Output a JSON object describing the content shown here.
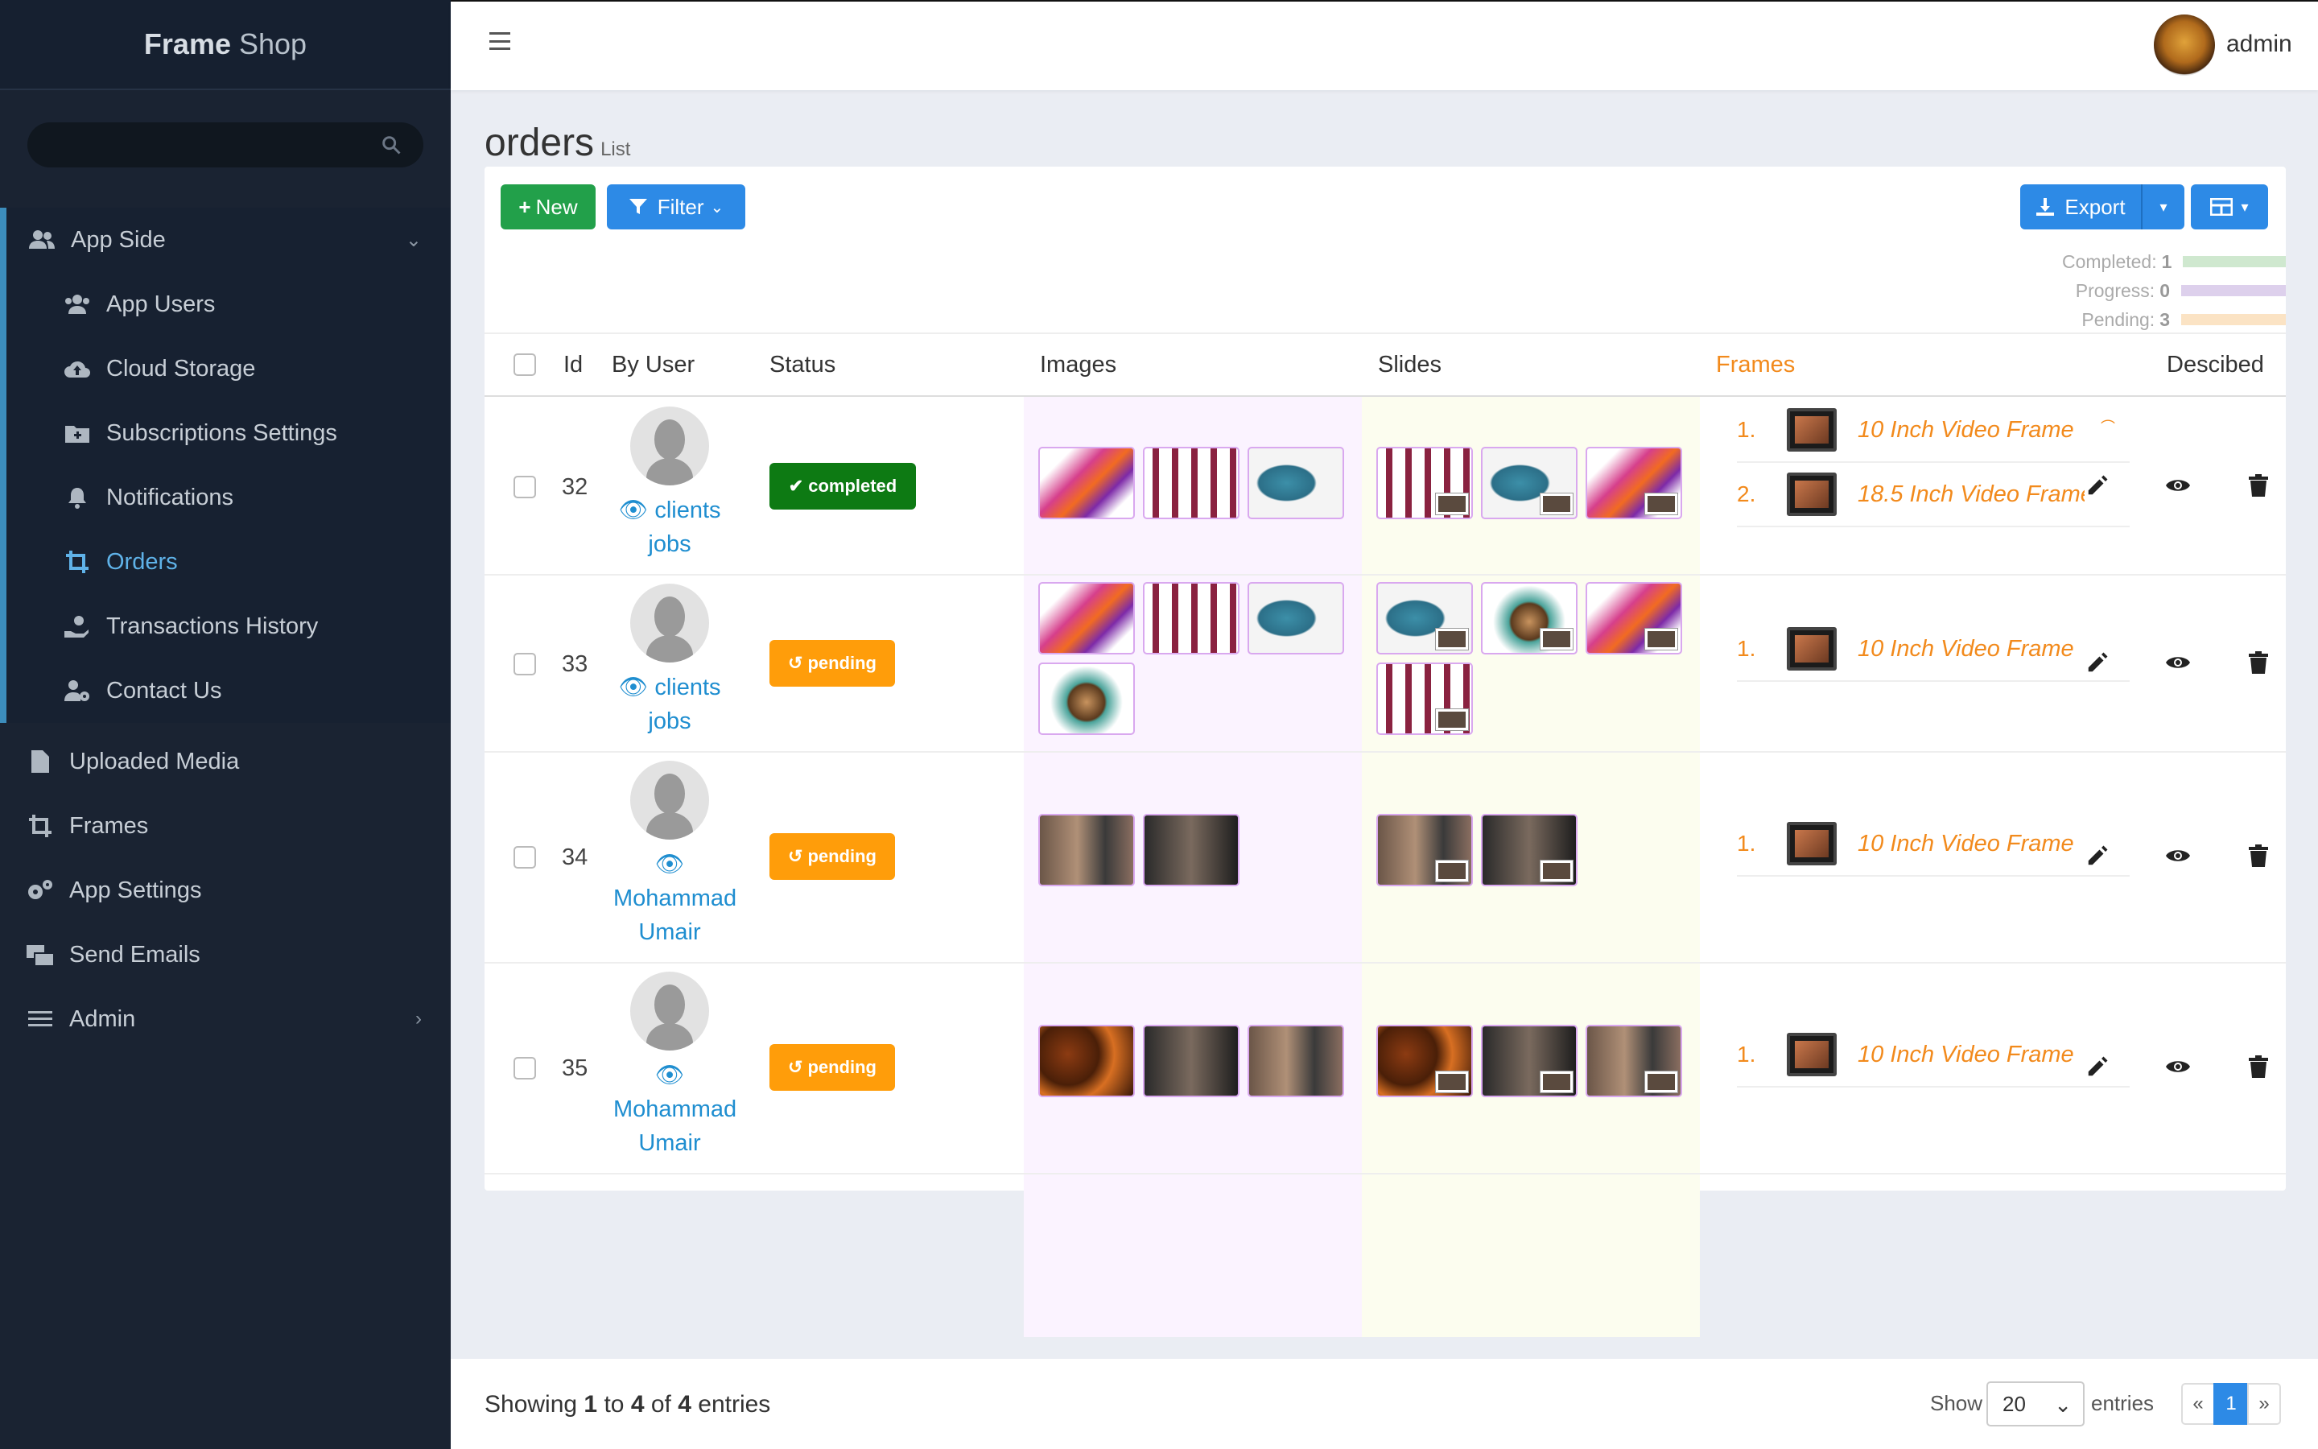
{
  "brand": {
    "bold": "Frame",
    "rest": "Shop"
  },
  "sidebar": {
    "group": {
      "label": "App Side",
      "items": [
        {
          "label": "App Users",
          "icon": "users-icon"
        },
        {
          "label": "Cloud Storage",
          "icon": "cloud-upload-icon"
        },
        {
          "label": "Subscriptions Settings",
          "icon": "folder-plus-icon"
        },
        {
          "label": "Notifications",
          "icon": "bell-icon"
        },
        {
          "label": "Orders",
          "icon": "crop-icon",
          "active": true
        },
        {
          "label": "Transactions History",
          "icon": "hand-coin-icon"
        },
        {
          "label": "Contact Us",
          "icon": "user-gear-icon"
        }
      ]
    },
    "items": [
      {
        "label": "Uploaded Media",
        "icon": "file-icon"
      },
      {
        "label": "Frames",
        "icon": "crop-icon"
      },
      {
        "label": "App Settings",
        "icon": "gears-icon"
      },
      {
        "label": "Send Emails",
        "icon": "mail-bulk-icon"
      },
      {
        "label": "Admin",
        "icon": "bars-icon"
      }
    ]
  },
  "header": {
    "user": "admin"
  },
  "page": {
    "title": "orders",
    "subtitle": "List"
  },
  "toolbar": {
    "new": "New",
    "filter": "Filter",
    "export": "Export"
  },
  "stats": {
    "completed_label": "Completed:",
    "completed": "1",
    "progress_label": "Progress:",
    "progress": "0",
    "pending_label": "Pending:",
    "pending": "3",
    "colors": {
      "completed": "#cfe8cf",
      "progress": "#ddd0ec",
      "pending": "#fbe3c4"
    }
  },
  "table": {
    "headers": {
      "id": "Id",
      "user": "By User",
      "status": "Status",
      "images": "Images",
      "slides": "Slides",
      "frames": "Frames",
      "desc": "Descibed"
    },
    "rows": [
      {
        "id": "32",
        "user": "clients jobs",
        "status": "completed",
        "frames": [
          {
            "n": "1.",
            "name": "10 Inch Video Frame"
          },
          {
            "n": "2.",
            "name": "18.5 Inch Video Frame"
          }
        ]
      },
      {
        "id": "33",
        "user": "clients jobs",
        "status": "pending",
        "frames": [
          {
            "n": "1.",
            "name": "10 Inch Video Frame"
          }
        ]
      },
      {
        "id": "34",
        "user": "Mohammad Umair",
        "status": "pending",
        "frames": [
          {
            "n": "1.",
            "name": "10 Inch Video Frame"
          }
        ]
      },
      {
        "id": "35",
        "user": "Mohammad Umair",
        "status": "pending",
        "frames": [
          {
            "n": "1.",
            "name": "10 Inch Video Frame"
          }
        ]
      }
    ]
  },
  "footer": {
    "showing_pre": "Showing",
    "from": "1",
    "to_word": "to",
    "to": "4",
    "of_word": "of",
    "total": "4",
    "entries_word": "entries",
    "show": "Show",
    "per_page": "20",
    "entries": "entries",
    "prev": "«",
    "page": "1",
    "next": "»"
  }
}
